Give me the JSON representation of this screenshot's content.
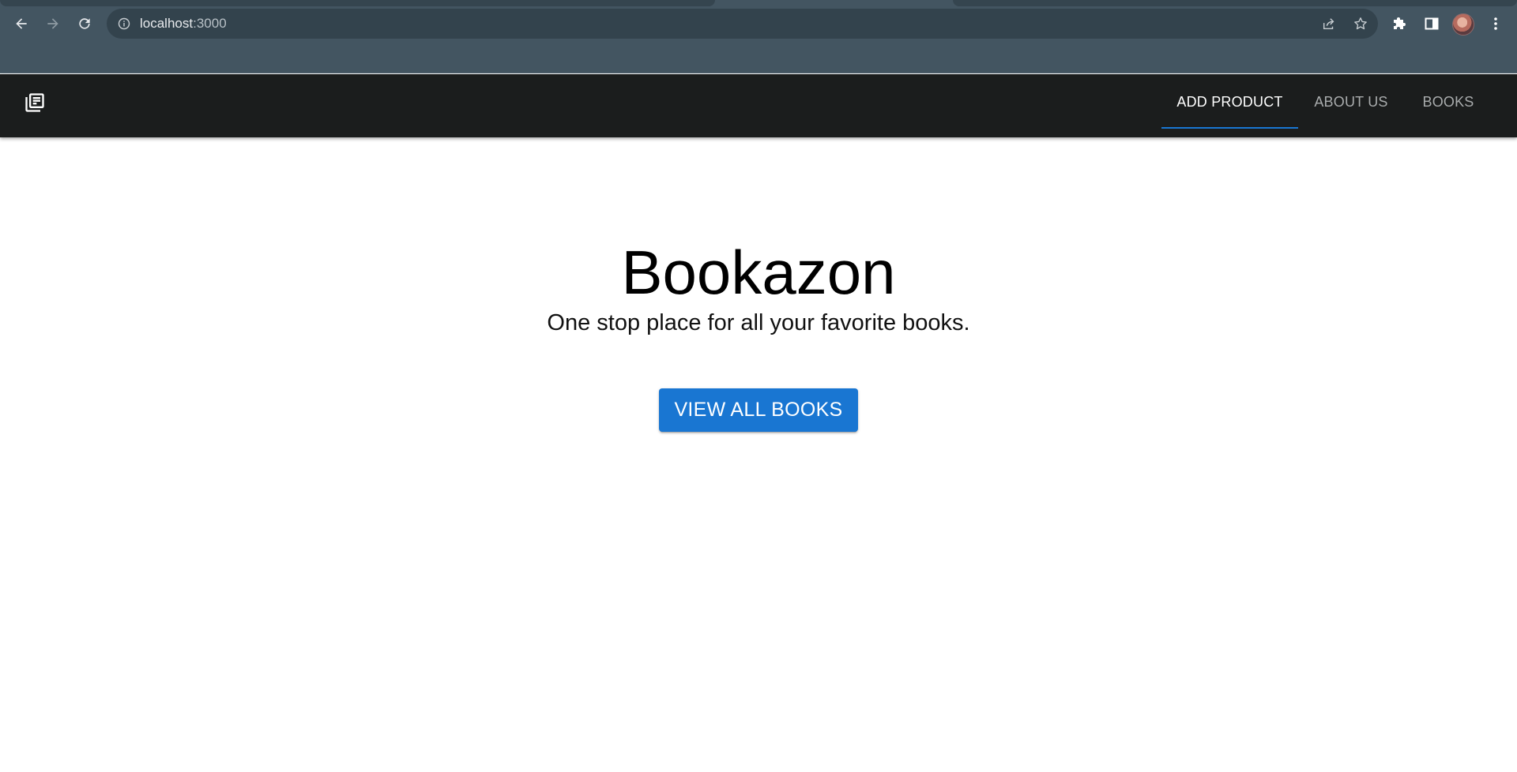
{
  "browser": {
    "url_host": "localhost",
    "url_port": ":3000",
    "icons": {
      "back": "back-arrow-icon",
      "forward": "forward-arrow-icon",
      "reload": "reload-icon",
      "site_info": "info-icon",
      "share": "share-icon",
      "bookmark": "star-icon",
      "extensions": "puzzle-icon",
      "side_panel": "side-panel-icon",
      "menu": "kebab-menu-icon"
    }
  },
  "appbar": {
    "logo_icon": "library-books-icon",
    "tabs": [
      {
        "label": "ADD PRODUCT",
        "active": true
      },
      {
        "label": "ABOUT US",
        "active": false
      },
      {
        "label": "BOOKS",
        "active": false
      }
    ]
  },
  "hero": {
    "title": "Bookazon",
    "subtitle": "One stop place for all your favorite books.",
    "cta_label": "VIEW ALL BOOKS"
  },
  "colors": {
    "chrome_bg": "#435561",
    "omnibox_bg": "#33434d",
    "appbar_bg": "#1b1d1d",
    "accent": "#1976d2",
    "active_tab_text": "#ffffff",
    "inactive_tab_text": "#a9acad"
  }
}
